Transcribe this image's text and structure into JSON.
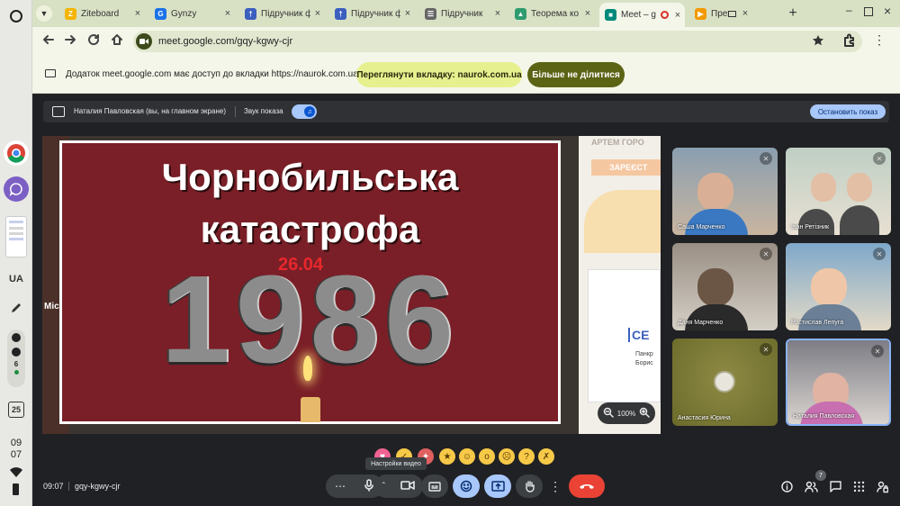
{
  "shelf": {
    "lang": "UA",
    "clock_h": "09",
    "clock_m": "07",
    "calendar_day": "25",
    "notif_count": "6"
  },
  "tabs": [
    {
      "title": "Ziteboard",
      "fav": "Z",
      "color": "#f4b400"
    },
    {
      "title": "Gynzy",
      "fav": "G",
      "color": "#1a73e8"
    },
    {
      "title": "Підручник ф",
      "fav": "†",
      "color": "#3b5fbf"
    },
    {
      "title": "Підручник ф",
      "fav": "†",
      "color": "#3b5fbf"
    },
    {
      "title": "Підручник",
      "fav": "☰",
      "color": "#666666"
    },
    {
      "title": "Теорема ко",
      "fav": "▲",
      "color": "#2e9c6e"
    },
    {
      "title": "Meet – g",
      "fav": "■",
      "color": "#00897b"
    },
    {
      "title": "Презент",
      "fav": "▶",
      "color": "#f29900"
    }
  ],
  "address": {
    "url": "meet.google.com/gqy-kgwy-cjr"
  },
  "infobar": {
    "message": "Додаток meet.google.com має доступ до вкладки https://naurok.com.ua",
    "view_tab": "Переглянути вкладку: naurok.com.ua",
    "stop_share": "Більше не ділитися"
  },
  "sharebar": {
    "presenter": "Наталия Павловская (вы, на главном экране)",
    "sound": "Звук показа",
    "stop": "Остановить показ"
  },
  "slide": {
    "line1": "Чорнобильська",
    "line2": "катастрофа",
    "date": "26.04",
    "year": "1986"
  },
  "behind": {
    "banner": "АРТЕМ ГОРО",
    "btn": "ЗАРЕЄСТ",
    "left_frag": "Міст",
    "card_frag": "СЕ",
    "card_sub1": "Панкр",
    "card_sub2": "Борис"
  },
  "zoom": {
    "level": "100%"
  },
  "participants": [
    {
      "name": "Саша Марченко",
      "bg1": "#8a9fb0",
      "bg2": "#c9b5a0",
      "face": "#d9b095",
      "shirt": "#3a78c2"
    },
    {
      "name": "Іван Ретізник",
      "bg1": "#bfcfc4",
      "bg2": "#e8e0d3",
      "face": "#e3bfa6",
      "shirt": "#4a4a4a"
    },
    {
      "name": "Даня Марченко",
      "bg1": "#9a8f84",
      "bg2": "#d4cfc6",
      "face": "#6b5645",
      "shirt": "#2a2a2a"
    },
    {
      "name": "Ростислав Лепуга",
      "bg1": "#7fa8c9",
      "bg2": "#e3dac8",
      "face": "#efc7a8",
      "shirt": "#6b7f96"
    },
    {
      "name": "Анастасия Юрина",
      "bg1": "#6b6b2a",
      "bg2": "#8e8a45",
      "face": "#e8e6dc",
      "shirt": "#b0ad90"
    },
    {
      "name": "Наталия Павловская",
      "bg1": "#7d7d85",
      "bg2": "#d9d4cf",
      "face": "#e0b3a3",
      "shirt": "#c76fb0"
    }
  ],
  "bottom": {
    "time": "09:07",
    "code": "gqy-kgwy-cjr",
    "tooltip": "Настройки видео",
    "people_count": "7"
  },
  "colors": {
    "slide_bg": "#7a1f27",
    "accent": "#a8c7fa",
    "end_call": "#ea4335"
  }
}
